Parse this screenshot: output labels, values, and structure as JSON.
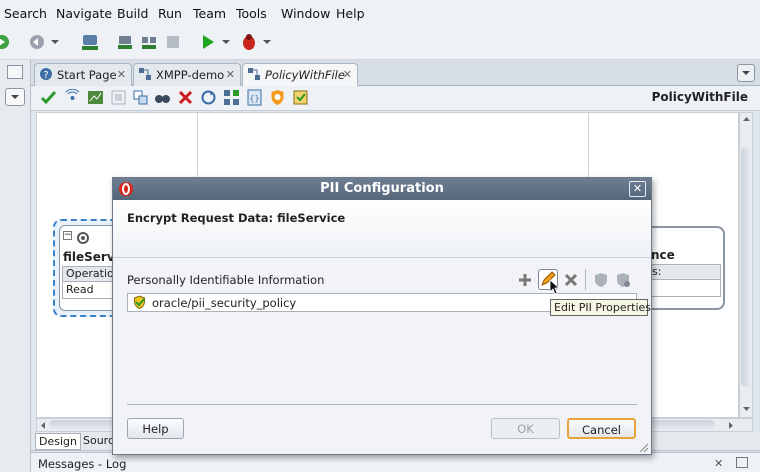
{
  "menu": {
    "items": [
      "Search",
      "Navigate",
      "Build",
      "Run",
      "Team",
      "Tools",
      "Window",
      "Help"
    ]
  },
  "tabs": [
    {
      "label": "Start Page"
    },
    {
      "label": "XMPP-demo"
    },
    {
      "label": "PolicyWithFile"
    }
  ],
  "editor": {
    "title": "PolicyWithFile"
  },
  "canvas": {
    "left_component": {
      "title": "fileServ",
      "row_header": "Operatio",
      "row_value": "Read"
    },
    "right_component": {
      "title": "nce",
      "row_header": "s:"
    }
  },
  "bottom_tabs": {
    "design": "Design",
    "source": "Sourc"
  },
  "messages": {
    "title": "Messages - Log"
  },
  "dialog": {
    "title": "PII Configuration",
    "subtitle": "Encrypt Request Data: fileService",
    "section_label": "Personally Identifiable Information",
    "policies": [
      "oracle/pii_security_policy"
    ],
    "tooltip": "Edit PII Properties",
    "help_label": "Help",
    "ok_label": "OK",
    "cancel_label": "Cancel"
  },
  "colors": {
    "accent": "#f59b1c",
    "title_bar": "#5f6f84",
    "check": "#2b9a2b",
    "delete": "#d01919"
  }
}
